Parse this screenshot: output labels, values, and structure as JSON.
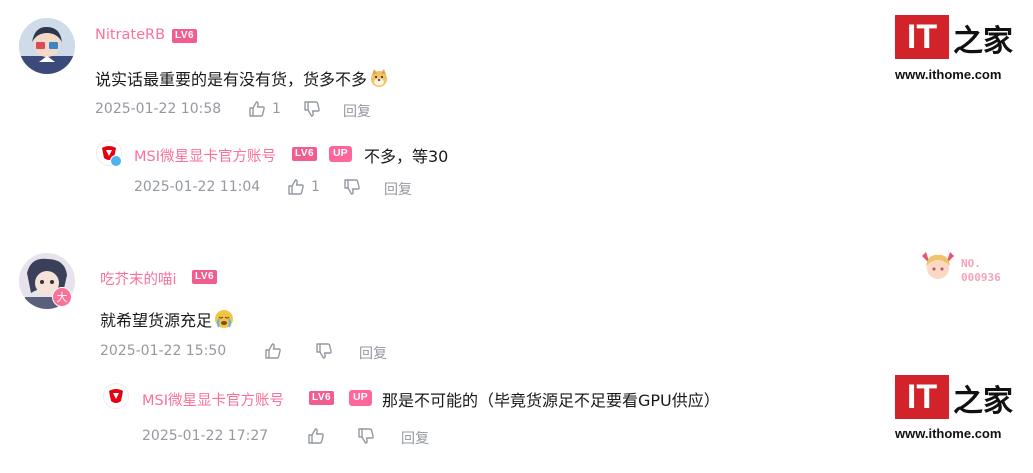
{
  "comments": [
    {
      "username": "NitrateRB",
      "level": "LV6",
      "text": "说实话最重要的是有没有货，货多不多",
      "time": "2025-01-22 10:58",
      "likes": "1",
      "reply_label": "回复",
      "reply": {
        "username": "MSI微星显卡官方账号",
        "level": "LV6",
        "up_badge": "UP",
        "text": "不多，等30",
        "time": "2025-01-22 11:04",
        "likes": "1",
        "reply_label": "回复"
      }
    },
    {
      "username": "吃芥末的喵i",
      "level": "LV6",
      "text": "就希望货源充足",
      "time": "2025-01-22 15:50",
      "reply_label": "回复",
      "avatar_badge": "大",
      "fan_badge": {
        "line1": "NO.",
        "line2": "000936"
      },
      "reply": {
        "username": "MSI微星显卡官方账号",
        "level": "LV6",
        "up_badge": "UP",
        "text": "那是不可能的（毕竟货源足不足要看GPU供应）",
        "time": "2025-01-22 17:27",
        "reply_label": "回复"
      }
    }
  ],
  "watermark": {
    "logo_text": "IT",
    "logo_cn": "之家",
    "url": "www.ithome.com"
  },
  "colors": {
    "username": "#fb7299",
    "meta": "#9499a0",
    "level_badge": "#f25d8e",
    "msi_red": "#e60012",
    "ithome_red": "#d2232a"
  }
}
